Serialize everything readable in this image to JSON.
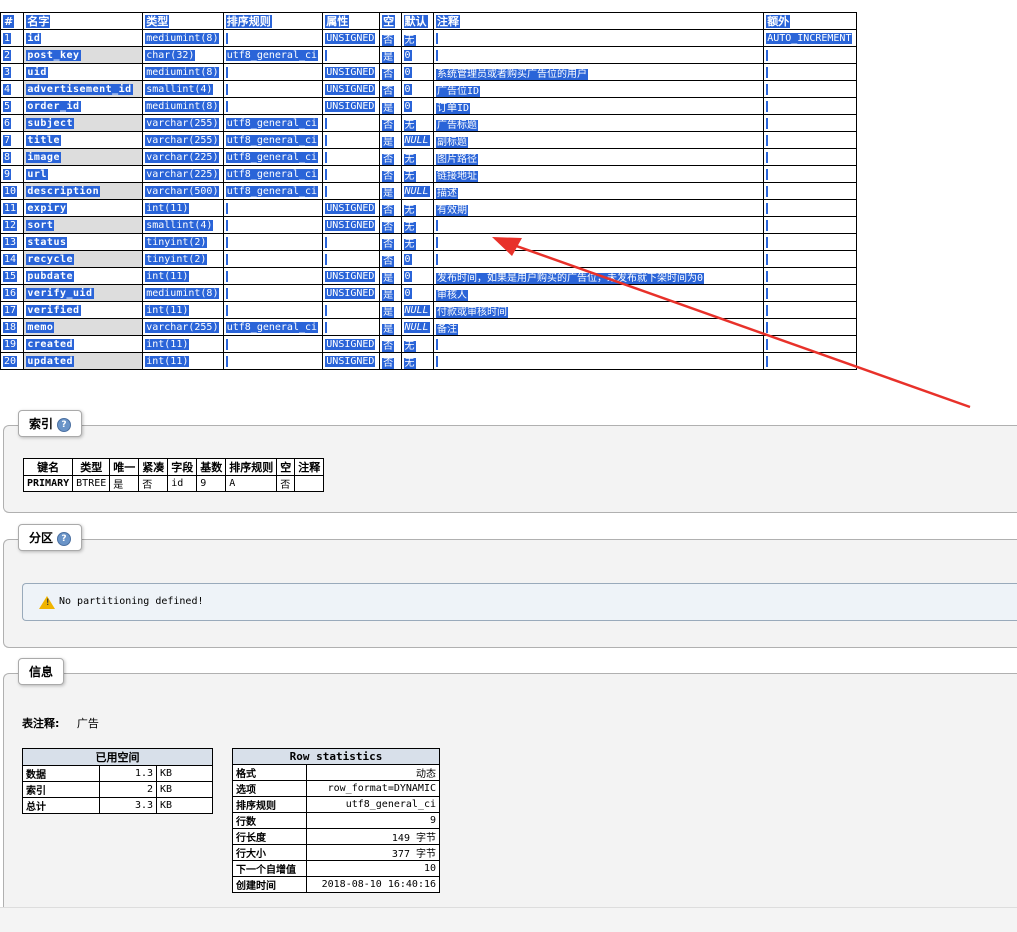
{
  "structure": {
    "headers": [
      "#",
      "名字",
      "类型",
      "排序规则",
      "属性",
      "空",
      "默认",
      "注释",
      "额外"
    ],
    "rows": [
      [
        "1",
        "id",
        "mediumint(8)",
        "",
        "UNSIGNED",
        "否",
        "无",
        "",
        "AUTO_INCREMENT"
      ],
      [
        "2",
        "post_key",
        "char(32)",
        "utf8_general_ci",
        "",
        "是",
        "0",
        "",
        ""
      ],
      [
        "3",
        "uid",
        "mediumint(8)",
        "",
        "UNSIGNED",
        "否",
        "0",
        "系统管理员或者购买广告位的用户",
        ""
      ],
      [
        "4",
        "advertisement_id",
        "smallint(4)",
        "",
        "UNSIGNED",
        "否",
        "0",
        "广告位ID",
        ""
      ],
      [
        "5",
        "order_id",
        "mediumint(8)",
        "",
        "UNSIGNED",
        "是",
        "0",
        "订单ID",
        ""
      ],
      [
        "6",
        "subject",
        "varchar(255)",
        "utf8_general_ci",
        "",
        "否",
        "无",
        "广告标题",
        ""
      ],
      [
        "7",
        "title",
        "varchar(255)",
        "utf8_general_ci",
        "",
        "是",
        "NULL",
        "副标题",
        ""
      ],
      [
        "8",
        "image",
        "varchar(225)",
        "utf8_general_ci",
        "",
        "否",
        "无",
        "图片路径",
        ""
      ],
      [
        "9",
        "url",
        "varchar(225)",
        "utf8_general_ci",
        "",
        "否",
        "无",
        "链接地址",
        ""
      ],
      [
        "10",
        "description",
        "varchar(500)",
        "utf8_general_ci",
        "",
        "是",
        "NULL",
        "描述",
        ""
      ],
      [
        "11",
        "expiry",
        "int(11)",
        "",
        "UNSIGNED",
        "否",
        "无",
        "有效期",
        ""
      ],
      [
        "12",
        "sort",
        "smallint(4)",
        "",
        "UNSIGNED",
        "否",
        "无",
        "",
        ""
      ],
      [
        "13",
        "status",
        "tinyint(2)",
        "",
        "",
        "否",
        "无",
        "",
        ""
      ],
      [
        "14",
        "recycle",
        "tinyint(2)",
        "",
        "",
        "否",
        "0",
        "",
        ""
      ],
      [
        "15",
        "pubdate",
        "int(11)",
        "",
        "UNSIGNED",
        "是",
        "0",
        "发布时间，如果是用户购买的广告位，未发布就下架时间为0",
        ""
      ],
      [
        "16",
        "verify_uid",
        "mediumint(8)",
        "",
        "UNSIGNED",
        "是",
        "0",
        "审核人",
        ""
      ],
      [
        "17",
        "verified",
        "int(11)",
        "",
        "",
        "是",
        "NULL",
        "付款或审核时间",
        ""
      ],
      [
        "18",
        "memo",
        "varchar(255)",
        "utf8_general_ci",
        "",
        "是",
        "NULL",
        "备注",
        ""
      ],
      [
        "19",
        "created",
        "int(11)",
        "",
        "UNSIGNED",
        "否",
        "无",
        "",
        ""
      ],
      [
        "20",
        "updated",
        "int(11)",
        "",
        "UNSIGNED",
        "否",
        "无",
        "",
        ""
      ]
    ]
  },
  "indexes": {
    "legend": "索引",
    "headers": [
      "键名",
      "类型",
      "唯一",
      "紧凑",
      "字段",
      "基数",
      "排序规则",
      "空",
      "注释"
    ],
    "rows": [
      [
        "PRIMARY",
        "BTREE",
        "是",
        "否",
        "id",
        "9",
        "A",
        "否",
        ""
      ]
    ]
  },
  "partitions": {
    "legend": "分区",
    "message": "No partitioning defined!"
  },
  "info": {
    "legend": "信息",
    "comment_label": "表注释:",
    "comment_value": "广告",
    "space": {
      "title": "已用空间",
      "rows": [
        [
          "数据",
          "1.3",
          "KB"
        ],
        [
          "索引",
          "2",
          "KB"
        ],
        [
          "总计",
          "3.3",
          "KB"
        ]
      ]
    },
    "row_stats": {
      "title": "Row statistics",
      "rows": [
        [
          "格式",
          "动态"
        ],
        [
          "选项",
          "row_format=DYNAMIC"
        ],
        [
          "排序规则",
          "utf8_general_ci"
        ],
        [
          "行数",
          "9"
        ],
        [
          "行长度",
          "149 字节"
        ],
        [
          "行大小",
          "377 字节"
        ],
        [
          "下一个自增值",
          "10"
        ],
        [
          "创建时间",
          "2018-08-10 16:40:16"
        ]
      ]
    }
  },
  "colors": {
    "selection": "#2a64d8",
    "arrow": "#e8312a"
  }
}
